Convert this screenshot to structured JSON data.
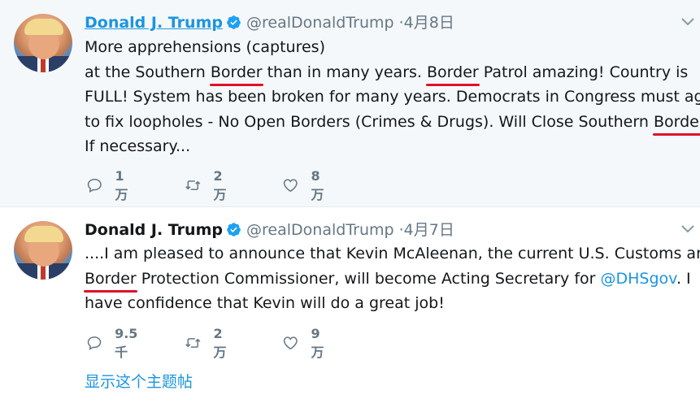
{
  "tweets": [
    {
      "name": "Donald J. Trump",
      "handle": "@realDonaldTrump",
      "dot": "·",
      "date": "4月8日",
      "lines": [
        [
          "More apprehensions (captures)"
        ],
        [
          "at the Southern ",
          "Border",
          " than in many years. ",
          "Border",
          " Patrol amazing! Country is"
        ],
        [
          "FULL! System has been broken for many years. Democrats in Congress must agree"
        ],
        [
          "to fix loopholes - No Open Borders (Crimes & Drugs). Will Close Southern ",
          "Border"
        ],
        [
          "If necessary..."
        ]
      ],
      "replies": "1万",
      "retweets": "2万",
      "likes": "8万"
    },
    {
      "name": "Donald J. Trump",
      "handle": "@realDonaldTrump",
      "dot": "·",
      "date": "4月7日",
      "line1": "....I am pleased to announce that Kevin McAleenan, the current U.S. Customs and",
      "line2a": "Border",
      "line2b": " Protection Commissioner, will become Acting Secretary for ",
      "line2link": "@DHSgov",
      "line2c": ". I",
      "line3": "have confidence that Kevin will do a great job!",
      "replies": "9.5千",
      "retweets": "2万",
      "likes": "9万"
    }
  ],
  "show_thread": "显示这个主题帖",
  "colors": {
    "link": "#1b95e0",
    "underline": "#e0112b",
    "muted": "#657786"
  }
}
